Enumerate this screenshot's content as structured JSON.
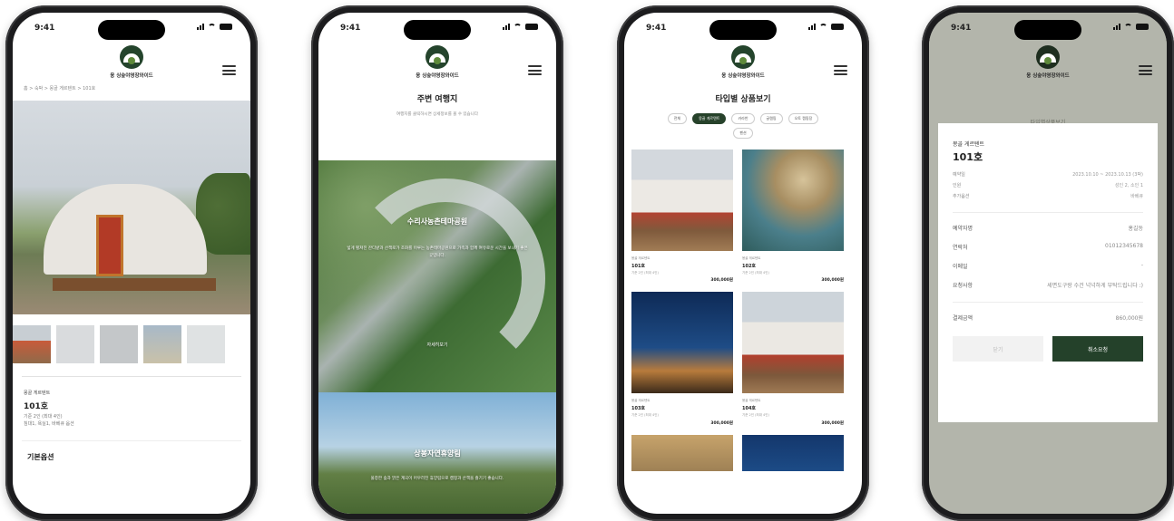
{
  "status": {
    "time": "9:41"
  },
  "brand": {
    "name": "웅 싱숲야영장와이드"
  },
  "colors": {
    "accent": "#24412a",
    "overlay": "#b3b5ab"
  },
  "screen1": {
    "breadcrumb": "홈 > 숙박 > 몽골 게르텐트 > 101호",
    "product_type": "몽골 게르텐트",
    "room": "101호",
    "detail_lines": [
      "기준 2인 (최대 4인)",
      "침대1, 욕실1, 바베큐 옵션"
    ],
    "section_title": "기본옵션"
  },
  "screen2": {
    "title": "주변 여행지",
    "desc": "여행지를 클릭하시면 상세정보를 볼 수 있습니다",
    "spots": [
      {
        "name": "수리사농촌테마공원",
        "text": "넓게 펼쳐진 잔디밭과 산책로가 조화를 이루는 농촌테마공원으로 가족과 함께 여유로운 시간을 보내기 좋은 곳입니다.",
        "link": "자세히보기"
      },
      {
        "name": "상봉자연휴양림",
        "text": "울창한 숲과 맑은 계곡이 어우러진 휴양림으로 캠핑과 산책을 즐기기 좋습니다.",
        "link": ""
      }
    ]
  },
  "screen3": {
    "title": "타입별 상품보기",
    "chips": [
      "전체",
      "몽골 게르텐트",
      "카라반",
      "글램핑",
      "오토 캠핑장",
      "펜션"
    ],
    "products": [
      {
        "type": "몽골 게르텐트",
        "room": "101호",
        "desc": "기준 2인 (최대 4인)",
        "price": "300,000원"
      },
      {
        "type": "몽골 게르텐트",
        "room": "102호",
        "desc": "기준 2인 (최대 4인)",
        "price": "300,000원"
      },
      {
        "type": "몽골 게르텐트",
        "room": "103호",
        "desc": "기준 2인 (최대 4인)",
        "price": "300,000원"
      },
      {
        "type": "몽골 게르텐트",
        "room": "104호",
        "desc": "기준 2인 (최대 4인)",
        "price": "300,000원"
      }
    ]
  },
  "screen4": {
    "behind_text": "타입별상품보기",
    "product_type": "몽골 게르텐트",
    "room": "101호",
    "rows": [
      {
        "label": "예약일",
        "value": "2023.10.10 ~ 2023.10.13 (3박)"
      },
      {
        "label": "인원",
        "value": "성인 2, 소인 1"
      },
      {
        "label": "추가옵션",
        "value": "바베큐"
      }
    ],
    "rows2": [
      {
        "label": "예약자명",
        "value": "홍길동"
      },
      {
        "label": "연락처",
        "value": "01012345678"
      },
      {
        "label": "이메일",
        "value": "-"
      },
      {
        "label": "요청사항",
        "value": "세면도구랑 수건 넉넉하게 부탁드립니다 :)"
      }
    ],
    "total_label": "결제금액",
    "total_value": "860,000원",
    "btn_close": "닫기",
    "btn_cancel": "취소요청"
  }
}
